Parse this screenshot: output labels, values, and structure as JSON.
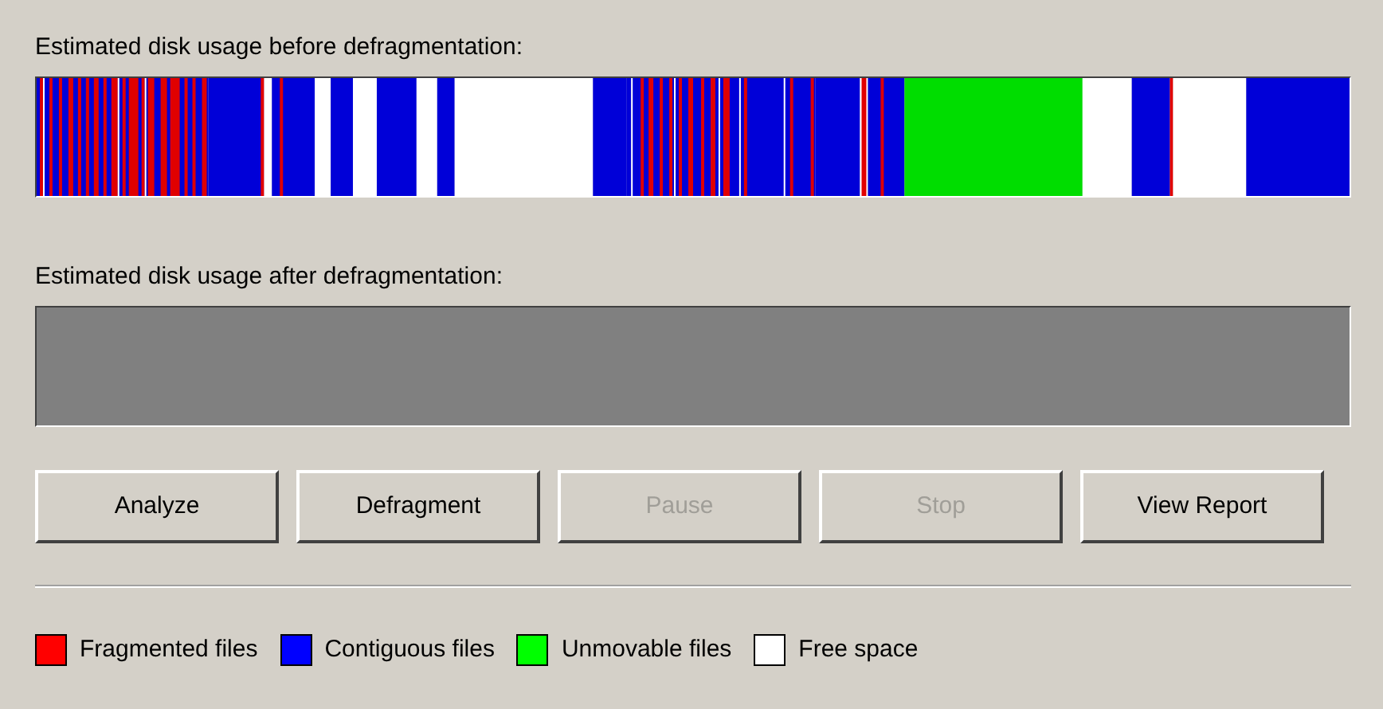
{
  "before_label": "Estimated disk usage before defragmentation:",
  "after_label": "Estimated disk usage after defragmentation:",
  "buttons": [
    {
      "label": "Analyze",
      "disabled": false
    },
    {
      "label": "Defragment",
      "disabled": false
    },
    {
      "label": "Pause",
      "disabled": true
    },
    {
      "label": "Stop",
      "disabled": true
    },
    {
      "label": "View Report",
      "disabled": false
    }
  ],
  "legend": [
    {
      "label": "Fragmented files",
      "color": "#ff0000"
    },
    {
      "label": "Contiguous files",
      "color": "#0000ff"
    },
    {
      "label": "Unmovable files",
      "color": "#00ff00"
    },
    {
      "label": "Free space",
      "color": "#ffffff"
    }
  ]
}
